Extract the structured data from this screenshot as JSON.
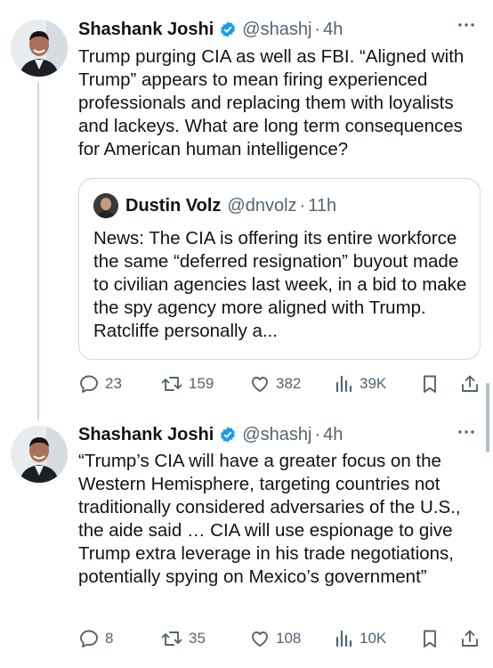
{
  "tweets": [
    {
      "name": "Shashank Joshi",
      "handle": "@shashj",
      "time": "4h",
      "text": "Trump purging CIA as well as FBI. “Aligned with Trump” appears to mean firing experienced professionals and replacing them with loyalists and lackeys. What are long term consequences for American human intelligence?",
      "quote": {
        "name": "Dustin Volz",
        "handle": "@dnvolz",
        "time": "11h",
        "text": "News: The CIA is offering its entire workforce the same “deferred resignation” buyout made to civilian agencies last week, in a bid to make the spy agency more aligned with Trump. Ratcliffe personally a..."
      },
      "replies": "23",
      "reposts": "159",
      "likes": "382",
      "views": "39K"
    },
    {
      "name": "Shashank Joshi",
      "handle": "@shashj",
      "time": "4h",
      "text": "“Trump’s CIA will have a greater focus on the Western Hemisphere, targeting countries not traditionally considered adversaries of the U.S., the aide said …  CIA will use espionage to give Trump extra leverage in his trade negotiations, potentially spying on Mexico’s government”",
      "replies": "8",
      "reposts": "35",
      "likes": "108",
      "views": "10K"
    }
  ],
  "separator": "·",
  "colors": {
    "text": "#0f1419",
    "muted": "#536471",
    "verified": "#1d9bf0",
    "border": "#cfd9de"
  },
  "icons": [
    "verified-badge-icon",
    "more-icon",
    "reply-icon",
    "repost-icon",
    "like-icon",
    "views-icon",
    "bookmark-icon",
    "share-icon"
  ]
}
